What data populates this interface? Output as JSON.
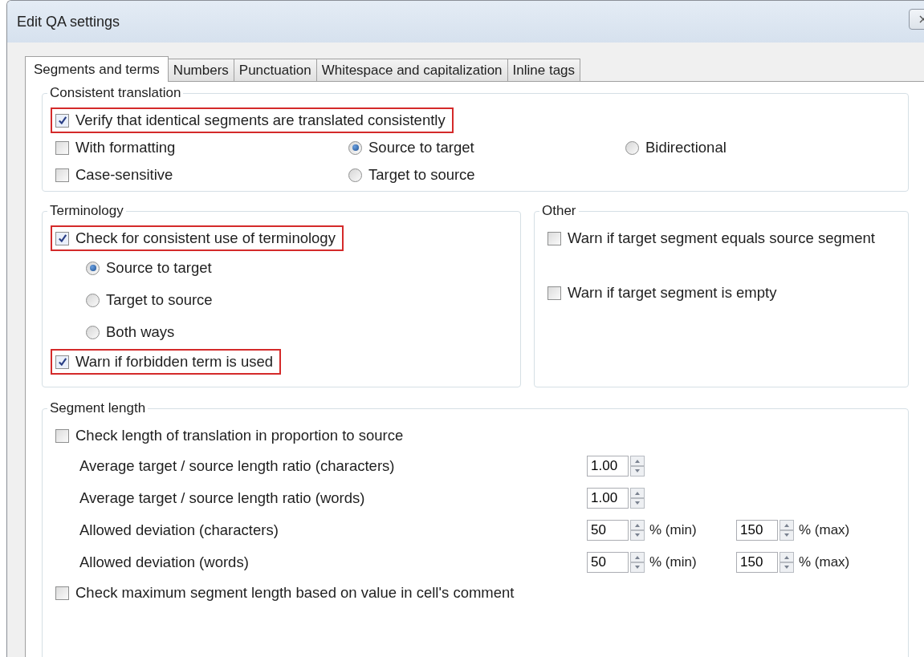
{
  "window": {
    "title": "Edit QA settings"
  },
  "tabs": [
    {
      "label": "Segments and terms",
      "selected": true
    },
    {
      "label": "Numbers",
      "selected": false
    },
    {
      "label": "Punctuation",
      "selected": false
    },
    {
      "label": "Whitespace and capitalization",
      "selected": false
    },
    {
      "label": "Inline tags",
      "selected": false
    }
  ],
  "consistent_translation": {
    "legend": "Consistent translation",
    "verify": {
      "label": "Verify that identical segments are translated consistently",
      "checked": true,
      "highlighted": true
    },
    "options": [
      {
        "label": "With formatting",
        "checked": false
      },
      {
        "label": "Case-sensitive",
        "checked": false
      }
    ],
    "directions": [
      {
        "label": "Source to target",
        "selected": true
      },
      {
        "label": "Target to source",
        "selected": false
      },
      {
        "label": "Bidirectional",
        "selected": false
      }
    ]
  },
  "terminology": {
    "legend": "Terminology",
    "check": {
      "label": "Check for consistent use of terminology",
      "checked": true,
      "highlighted": true
    },
    "directions": [
      {
        "label": "Source to target",
        "selected": true
      },
      {
        "label": "Target to source",
        "selected": false
      },
      {
        "label": "Both ways",
        "selected": false
      }
    ],
    "forbidden": {
      "label": "Warn if forbidden term is used",
      "checked": true,
      "highlighted": true
    }
  },
  "other": {
    "legend": "Other",
    "checks": [
      {
        "label": "Warn if target segment equals source segment",
        "checked": false
      },
      {
        "label": "Warn if target segment is empty",
        "checked": false
      }
    ]
  },
  "segment_length": {
    "legend": "Segment length",
    "proportion": {
      "label": "Check length of translation in proportion to source",
      "checked": false
    },
    "ratios": [
      {
        "label": "Average target / source length ratio (characters)",
        "value": "1.00"
      },
      {
        "label": "Average target / source length ratio (words)",
        "value": "1.00"
      }
    ],
    "deviations": [
      {
        "label": "Allowed deviation (characters)",
        "min": "50",
        "min_unit": "% (min)",
        "max": "150",
        "max_unit": "% (max)"
      },
      {
        "label": "Allowed deviation (words)",
        "min": "50",
        "min_unit": "% (min)",
        "max": "150",
        "max_unit": "% (max)"
      }
    ],
    "max_length": {
      "label": "Check maximum segment length based on value in cell's comment",
      "checked": false
    }
  }
}
